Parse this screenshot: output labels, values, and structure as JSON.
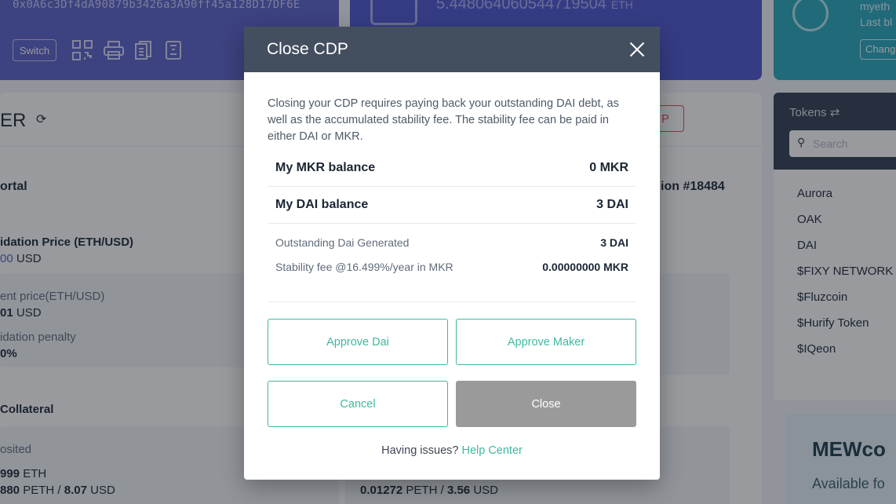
{
  "background": {
    "address": "0x0A6c3Df4dA90879b3426a3A90ff45a128D17DF6E",
    "switch_label": "Switch",
    "balance": "5.44806406054471950​4",
    "balance_unit": "ETH",
    "network_lines": [
      "myeth",
      "Last bl"
    ],
    "change_label": "Chang",
    "page_heading": "ER",
    "red_button": "P",
    "portal_label": "ortal",
    "position_label": "ion #18484",
    "liq_price_label": "idation Price (ETH/USD)",
    "liq_price_value": "00",
    "liq_price_unit": "USD",
    "current_price_label": "ent price(ETH/USD)",
    "current_price_value": "01",
    "current_price_unit": "USD",
    "penalty_label": "idation penalty",
    "penalty_value": "0%",
    "collateral_label": "Collateral",
    "deposited_label": "osited",
    "deposited_eth": "999",
    "deposited_eth_unit": "ETH",
    "deposited_peth": "880",
    "deposited_peth_unit": "PETH",
    "deposited_usd": "8.07",
    "deposited_usd_unit": "USD",
    "right_peth": "0.01272",
    "right_peth_unit": "PETH",
    "right_usd": "3.56",
    "right_usd_unit": "USD",
    "tokens_label": "Tokens",
    "search_placeholder": "Search",
    "tokens": [
      "Aurora",
      "OAK",
      "DAI",
      "$FIXY NETWORK",
      "$Fluzcoin",
      "$Hurify Token",
      "$IQeon"
    ],
    "promo_title": "MEWco",
    "promo_sub": "Available fo"
  },
  "modal": {
    "title": "Close CDP",
    "description": "Closing your CDP requires paying back your outstanding DAI debt, as well as the accumulated stability fee. The stability fee can be paid in either DAI or MKR.",
    "mkr_balance_label": "My MKR balance",
    "mkr_balance_value": "0 MKR",
    "dai_balance_label": "My DAI balance",
    "dai_balance_value": "3 DAI",
    "outstanding_label": "Outstanding Dai Generated",
    "outstanding_value": "3 DAI",
    "fee_label": "Stability fee @16.499%/year in MKR",
    "fee_value": "0.00000000 MKR",
    "approve_dai": "Approve Dai",
    "approve_maker": "Approve Maker",
    "cancel": "Cancel",
    "close": "Close",
    "help_prefix": "Having issues?",
    "help_link": "Help Center"
  }
}
